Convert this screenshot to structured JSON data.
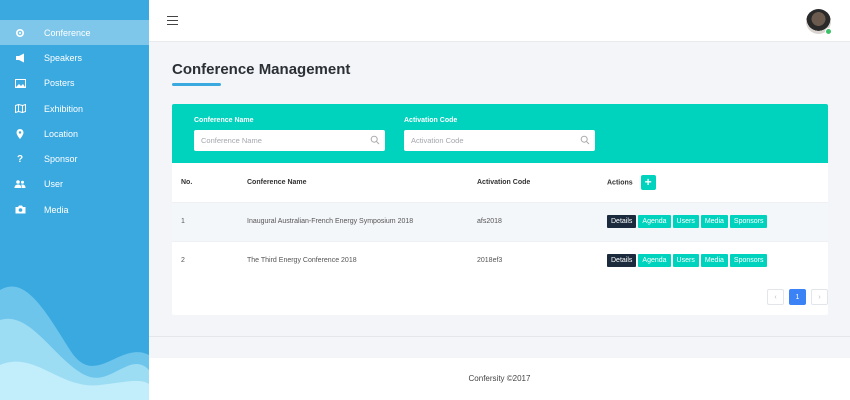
{
  "sidebar": {
    "items": [
      {
        "label": "Conference",
        "icon": "gear-icon",
        "active": true
      },
      {
        "label": "Speakers",
        "icon": "megaphone-icon"
      },
      {
        "label": "Posters",
        "icon": "image-icon"
      },
      {
        "label": "Exhibition",
        "icon": "map-icon"
      },
      {
        "label": "Location",
        "icon": "location-pin-icon"
      },
      {
        "label": "Sponsor",
        "icon": "question-icon"
      },
      {
        "label": "User",
        "icon": "users-icon"
      },
      {
        "label": "Media",
        "icon": "camera-icon"
      }
    ]
  },
  "page": {
    "title": "Conference Management"
  },
  "filter": {
    "conference_label": "Conference Name",
    "conference_placeholder": "Conference Name",
    "code_label": "Activation Code",
    "code_placeholder": "Activation Code"
  },
  "table": {
    "headers": [
      "No.",
      "Conference Name",
      "Activation Code",
      "Actions"
    ],
    "rows": [
      {
        "no": "1",
        "name": "Inaugural Australian-French Energy Symposium 2018",
        "code": "afs2018"
      },
      {
        "no": "2",
        "name": "The Third Energy Conference 2018",
        "code": "2018ef3"
      }
    ],
    "actions": [
      "Details",
      "Agenda",
      "Users",
      "Media",
      "Sponsors"
    ]
  },
  "pagination": {
    "prev": "‹",
    "current": "1",
    "next": "›"
  },
  "footer": {
    "text": "Confersity ©2017"
  },
  "colors": {
    "sidebar": "#3aa9e0",
    "accent": "#00d3bd",
    "dark_button": "#1b2a3d",
    "page_active": "#3b82f6"
  }
}
